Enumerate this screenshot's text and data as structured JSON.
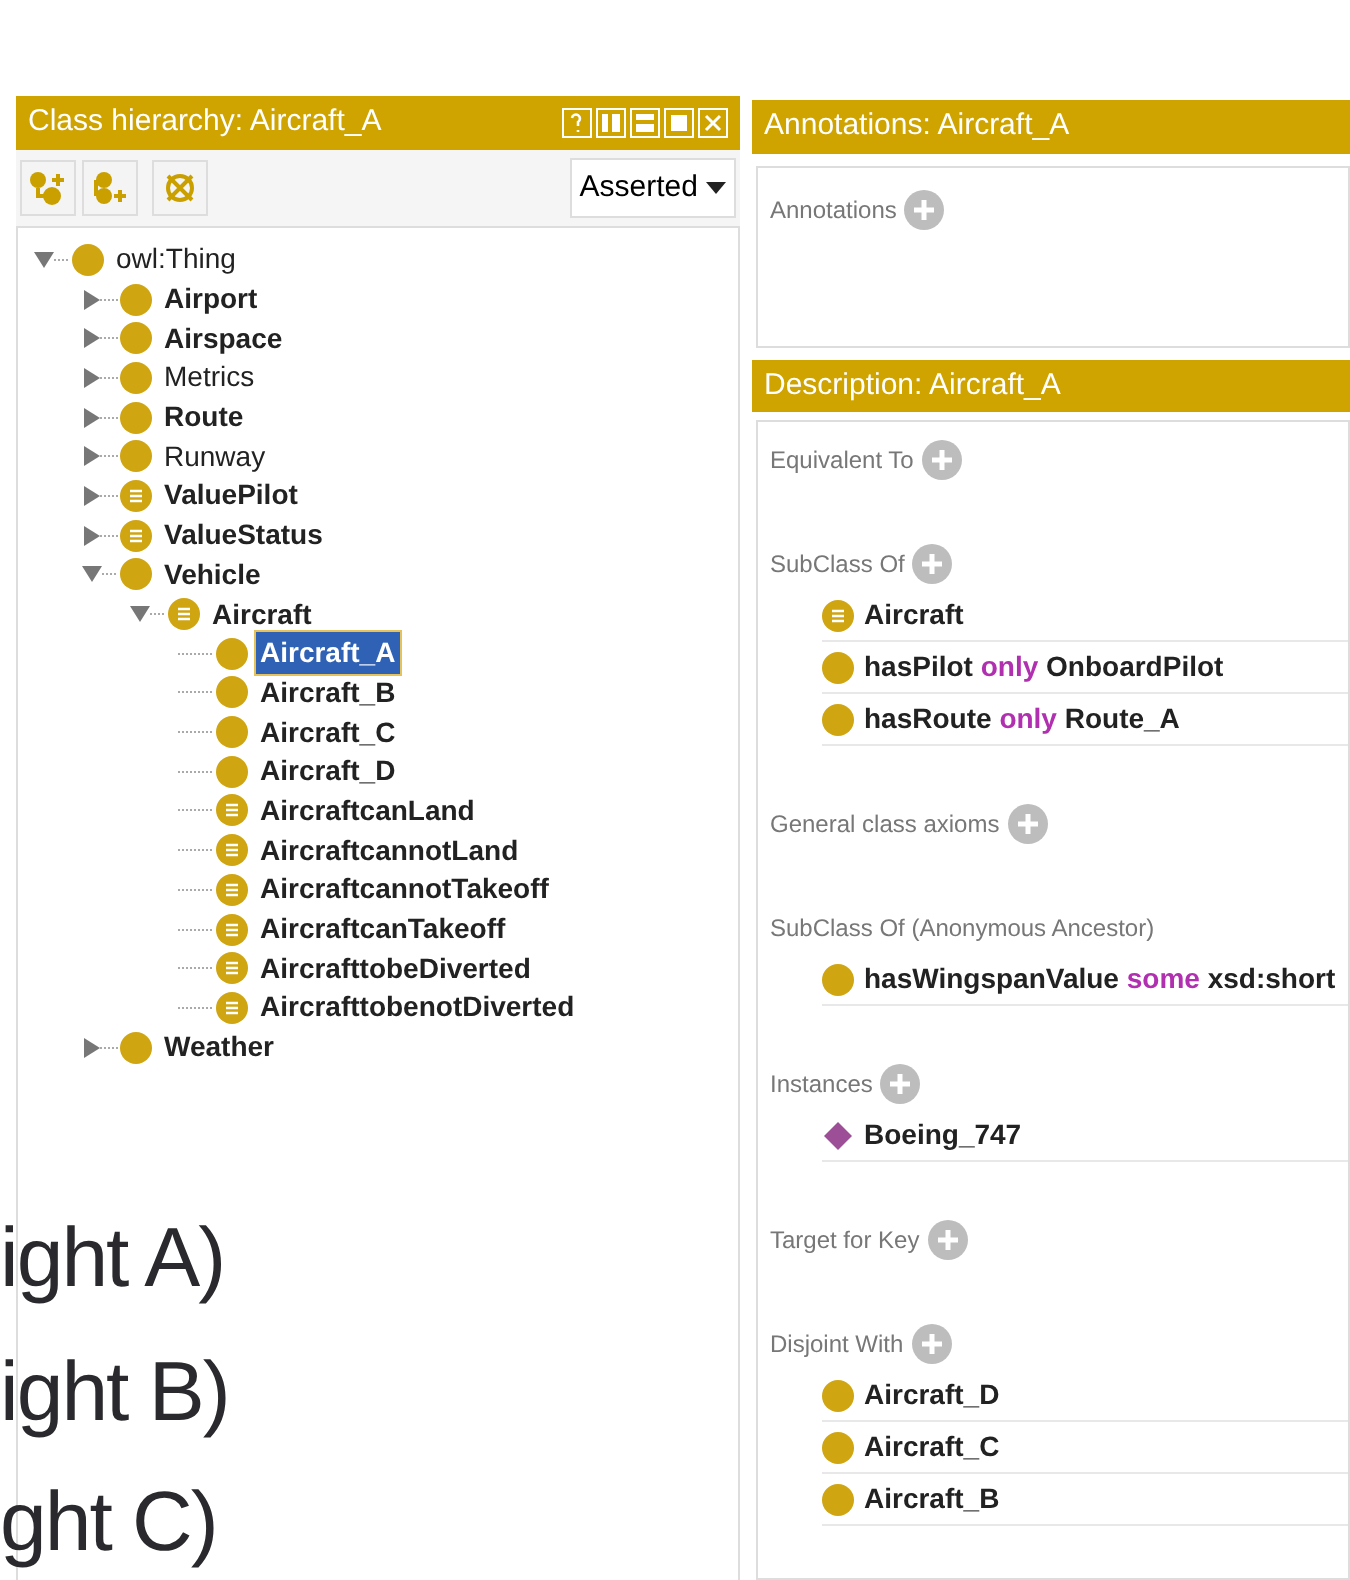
{
  "class_hierarchy": {
    "title": "Class hierarchy: Aircraft_A",
    "mode": "Asserted",
    "tree": [
      {
        "label": "owl:Thing",
        "kind": "primitive",
        "bold": false,
        "selected": false,
        "expanded": true,
        "children": [
          {
            "label": "Airport",
            "kind": "primitive",
            "bold": true,
            "selected": false,
            "expanded": false
          },
          {
            "label": "Airspace",
            "kind": "primitive",
            "bold": true,
            "selected": false,
            "expanded": false
          },
          {
            "label": "Metrics",
            "kind": "primitive",
            "bold": false,
            "selected": false,
            "expanded": false
          },
          {
            "label": "Route",
            "kind": "primitive",
            "bold": true,
            "selected": false,
            "expanded": false
          },
          {
            "label": "Runway",
            "kind": "primitive",
            "bold": false,
            "selected": false,
            "expanded": false
          },
          {
            "label": "ValuePilot",
            "kind": "defined",
            "bold": true,
            "selected": false,
            "expanded": false
          },
          {
            "label": "ValueStatus",
            "kind": "defined",
            "bold": true,
            "selected": false,
            "expanded": false
          },
          {
            "label": "Vehicle",
            "kind": "primitive",
            "bold": true,
            "selected": false,
            "expanded": true,
            "children": [
              {
                "label": "Aircraft",
                "kind": "defined",
                "bold": true,
                "selected": false,
                "expanded": true,
                "children": [
                  {
                    "label": "Aircraft_A",
                    "kind": "primitive",
                    "bold": true,
                    "selected": true
                  },
                  {
                    "label": "Aircraft_B",
                    "kind": "primitive",
                    "bold": true,
                    "selected": false
                  },
                  {
                    "label": "Aircraft_C",
                    "kind": "primitive",
                    "bold": true,
                    "selected": false
                  },
                  {
                    "label": "Aircraft_D",
                    "kind": "primitive",
                    "bold": true,
                    "selected": false
                  },
                  {
                    "label": "AircraftcanLand",
                    "kind": "defined",
                    "bold": true,
                    "selected": false
                  },
                  {
                    "label": "AircraftcannotLand",
                    "kind": "defined",
                    "bold": true,
                    "selected": false
                  },
                  {
                    "label": "AircraftcannotTakeoff",
                    "kind": "defined",
                    "bold": true,
                    "selected": false
                  },
                  {
                    "label": "AircraftcanTakeoff",
                    "kind": "defined",
                    "bold": true,
                    "selected": false
                  },
                  {
                    "label": "AircrafttobeDiverted",
                    "kind": "defined",
                    "bold": true,
                    "selected": false
                  },
                  {
                    "label": "AircrafttobenotDiverted",
                    "kind": "defined",
                    "bold": true,
                    "selected": false
                  }
                ]
              }
            ]
          },
          {
            "label": "Weather",
            "kind": "primitive",
            "bold": true,
            "selected": false,
            "expanded": false
          }
        ]
      }
    ]
  },
  "annotations": {
    "title": "Annotations: Aircraft_A",
    "sections": [
      {
        "label": "Annotations",
        "add": true
      }
    ]
  },
  "description": {
    "title": "Description: Aircraft_A",
    "sections": [
      {
        "label": "Equivalent To",
        "add": true
      },
      {
        "label": "SubClass Of",
        "add": true,
        "items": [
          {
            "kind": "defined",
            "parts": [
              {
                "text": "Aircraft",
                "kind": "name"
              }
            ]
          },
          {
            "kind": "primitive",
            "parts": [
              {
                "text": "hasPilot",
                "kind": "name"
              },
              {
                "text": "only",
                "kind": "keyword"
              },
              {
                "text": "OnboardPilot",
                "kind": "name"
              }
            ]
          },
          {
            "kind": "primitive",
            "parts": [
              {
                "text": "hasRoute",
                "kind": "name"
              },
              {
                "text": "only",
                "kind": "keyword"
              },
              {
                "text": "Route_A",
                "kind": "name"
              }
            ]
          }
        ]
      },
      {
        "label": "General class axioms",
        "add": true
      },
      {
        "label": "SubClass Of (Anonymous Ancestor)",
        "add": false,
        "items": [
          {
            "kind": "primitive",
            "parts": [
              {
                "text": "hasWingspanValue",
                "kind": "name"
              },
              {
                "text": "some",
                "kind": "keyword"
              },
              {
                "text": "xsd:short",
                "kind": "name"
              }
            ]
          }
        ]
      },
      {
        "label": "Instances",
        "add": true,
        "items": [
          {
            "kind": "individual",
            "parts": [
              {
                "text": "Boeing_747",
                "kind": "name"
              }
            ]
          }
        ]
      },
      {
        "label": "Target for Key",
        "add": true
      },
      {
        "label": "Disjoint With",
        "add": true,
        "items": [
          {
            "kind": "primitive",
            "parts": [
              {
                "text": "Aircraft_D",
                "kind": "name"
              }
            ]
          },
          {
            "kind": "primitive",
            "parts": [
              {
                "text": "Aircraft_C",
                "kind": "name"
              }
            ]
          },
          {
            "kind": "primitive",
            "parts": [
              {
                "text": "Aircraft_B",
                "kind": "name"
              }
            ]
          }
        ]
      }
    ]
  },
  "overlay_text": [
    "ight A)",
    "ight B)",
    "ght C)"
  ]
}
